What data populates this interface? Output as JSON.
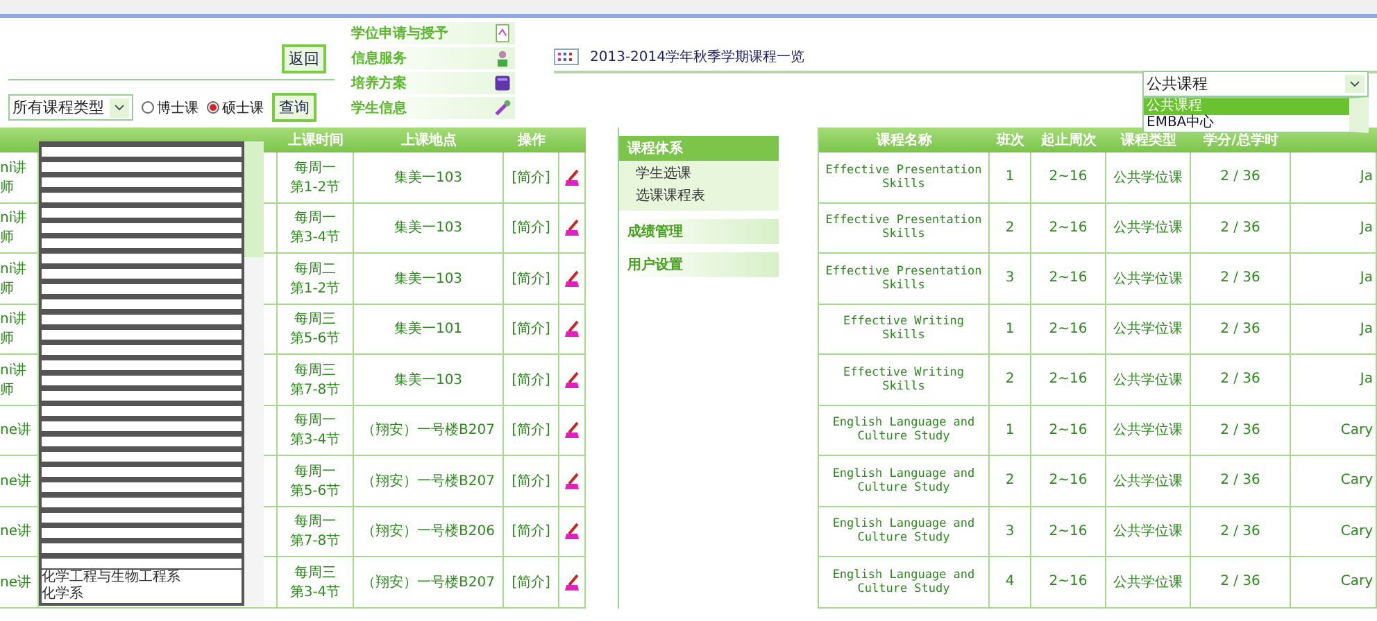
{
  "back_button": "返回",
  "filter": {
    "course_type": "所有课程类型",
    "options": [
      {
        "label": "博士课",
        "selected": false
      },
      {
        "label": "硕士课",
        "selected": true
      }
    ],
    "query_button": "查询"
  },
  "top_menu": [
    {
      "label": "学位申请与授予",
      "kind": "form"
    },
    {
      "label": "信息服务",
      "kind": "person"
    },
    {
      "label": "培养方案",
      "kind": "book"
    },
    {
      "label": "学生信息",
      "kind": "tool"
    }
  ],
  "page_title": "2013-2014学年秋季学期课程一览",
  "category_select": {
    "value": "公共课程",
    "options": [
      {
        "label": "公共课程",
        "selected": true
      },
      {
        "label": "EMBA中心",
        "selected": false
      }
    ]
  },
  "department_list": [
    "化学工程与生物工程系",
    "化学系"
  ],
  "schedule_table": {
    "columns": [
      "上课时间",
      "上课地点",
      "操作"
    ],
    "rows": [
      {
        "column_1": "ni讲师",
        "time": [
          "每周一",
          "第1-2节"
        ],
        "place": "集美一103",
        "action": "[简介]"
      },
      {
        "column_1": "ni讲师",
        "time": [
          "每周一",
          "第3-4节"
        ],
        "place": "集美一103",
        "action": "[简介]"
      },
      {
        "column_1": "ni讲师",
        "time": [
          "每周二",
          "第1-2节"
        ],
        "place": "集美一103",
        "action": "[简介]"
      },
      {
        "column_1": "ni讲师",
        "time": [
          "每周三",
          "第5-6节"
        ],
        "place": "集美一101",
        "action": "[简介]"
      },
      {
        "column_1": "ni讲师",
        "time": [
          "每周三",
          "第7-8节"
        ],
        "place": "集美一103",
        "action": "[简介]"
      },
      {
        "column_1": "ne讲",
        "time": [
          "每周一",
          "第3-4节"
        ],
        "place": "（翔安）一号楼B207",
        "action": "[简介]"
      },
      {
        "column_1": "ne讲",
        "time": [
          "每周一",
          "第5-6节"
        ],
        "place": "（翔安）一号楼B207",
        "action": "[简介]"
      },
      {
        "column_1": "ne讲",
        "time": [
          "每周一",
          "第7-8节"
        ],
        "place": "（翔安）一号楼B206",
        "action": "[简介]"
      },
      {
        "column_1": "ne讲",
        "time": [
          "每周三",
          "第3-4节"
        ],
        "place": "（翔安）一号楼B207",
        "action": "[简介]"
      }
    ]
  },
  "side_menu": [
    {
      "label": "课程体系",
      "expanded": true,
      "children": [
        "学生选课",
        "选课课程表"
      ]
    },
    {
      "label": "成绩管理",
      "expanded": false
    },
    {
      "label": "用户设置",
      "expanded": false
    }
  ],
  "course_table": {
    "columns": [
      "课程名称",
      "班次",
      "起止周次",
      "课程类型",
      "学分/总学时"
    ],
    "rows": [
      [
        "Effective Presentation Skills",
        "1",
        "2~16",
        "公共学位课",
        "2 / 36",
        "Ja"
      ],
      [
        "Effective Presentation Skills",
        "2",
        "2~16",
        "公共学位课",
        "2 / 36",
        "Ja"
      ],
      [
        "Effective Presentation Skills",
        "3",
        "2~16",
        "公共学位课",
        "2 / 36",
        "Ja"
      ],
      [
        "Effective Writing Skills",
        "1",
        "2~16",
        "公共学位课",
        "2 / 36",
        "Ja"
      ],
      [
        "Effective Writing Skills",
        "2",
        "2~16",
        "公共学位课",
        "2 / 36",
        "Ja"
      ],
      [
        "English Language and Culture Study",
        "1",
        "2~16",
        "公共学位课",
        "2 / 36",
        "Cary"
      ],
      [
        "English Language and Culture Study",
        "2",
        "2~16",
        "公共学位课",
        "2 / 36",
        "Cary"
      ],
      [
        "English Language and Culture Study",
        "3",
        "2~16",
        "公共学位课",
        "2 / 36",
        "Cary"
      ],
      [
        "English Language and Culture Study",
        "4",
        "2~16",
        "公共学位课",
        "2 / 36",
        "Cary"
      ]
    ]
  }
}
